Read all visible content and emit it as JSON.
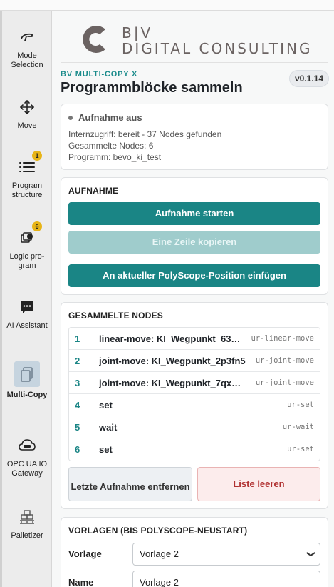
{
  "sidebar": {
    "items": [
      {
        "label": "Mode Selection",
        "icon": "hand-pointer-icon"
      },
      {
        "label": "Move",
        "icon": "move-arrows-icon"
      },
      {
        "label": "Program structure",
        "icon": "list-icon",
        "badge": "1"
      },
      {
        "label": "Logic pro-gram",
        "icon": "logic-program-icon",
        "badge": "6"
      },
      {
        "label": "AI Assistant",
        "icon": "chat-bubble-icon"
      },
      {
        "label": "Multi-Copy",
        "icon": "copy-icon",
        "active": true
      },
      {
        "label": "OPC UA IO Gateway",
        "icon": "cloud-icon"
      },
      {
        "label": "Palletizer",
        "icon": "pallet-icon"
      }
    ]
  },
  "header": {
    "logo_text_top": "B|V",
    "logo_text_bottom": "DIGITAL CONSULTING",
    "product": "BV MULTI-COPY X",
    "title": "Programmblöcke sammeln",
    "version": "v0.1.14"
  },
  "status": {
    "title": "Aufnahme aus",
    "lines": [
      "Internzugriff: bereit - 37 Nodes gefunden",
      "Gesammelte Nodes: 6",
      "Programm: bevo_ki_test"
    ]
  },
  "recording": {
    "title": "AUFNAHME",
    "start_label": "Aufnahme starten",
    "copy_line_label": "Eine Zeile kopieren",
    "insert_label": "An aktueller PolyScope-Position einfügen"
  },
  "nodes": {
    "title": "GESAMMELTE NODES",
    "rows": [
      {
        "num": "1",
        "name": "linear-move: KI_Wegpunkt_63…",
        "type": "ur-linear-move"
      },
      {
        "num": "2",
        "name": "joint-move: KI_Wegpunkt_2p3fn5",
        "type": "ur-joint-move"
      },
      {
        "num": "3",
        "name": "joint-move: KI_Wegpunkt_7qx…",
        "type": "ur-joint-move"
      },
      {
        "num": "4",
        "name": "set",
        "type": "ur-set"
      },
      {
        "num": "5",
        "name": "wait",
        "type": "ur-wait"
      },
      {
        "num": "6",
        "name": "set",
        "type": "ur-set"
      }
    ],
    "remove_last_label": "Letzte Aufnahme entfernen",
    "clear_label": "Liste leeren"
  },
  "templates": {
    "title": "VORLAGEN (BIS POLYSCOPE-NEUSTART)",
    "template_label": "Vorlage",
    "template_value": "Vorlage 2",
    "name_label": "Name",
    "name_value": "Vorlage 2"
  },
  "colors": {
    "accent": "#1a8585",
    "accent_disabled": "#9fcccc",
    "danger": "#b03030",
    "badge": "#e7b417"
  }
}
